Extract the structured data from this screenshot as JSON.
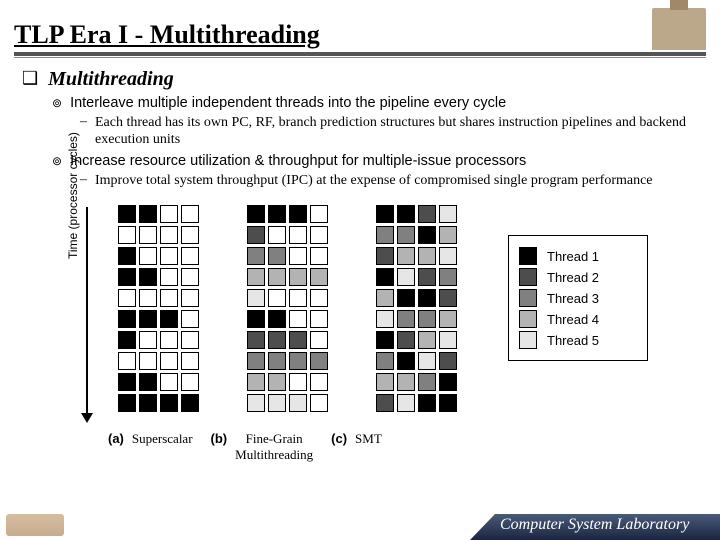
{
  "title": "TLP Era I - Multithreading",
  "section": "Multithreading",
  "bullets": {
    "b1": "Interleave multiple independent threads into the pipeline every cycle",
    "b1s": "Each thread has its own PC, RF, branch prediction structures but shares instruction pipelines and backend execution units",
    "b2": "Increase resource utilization & throughput for multiple-issue processors",
    "b2s": "Improve total system throughput (IPC) at the expense of compromised single program performance"
  },
  "figure": {
    "ylabel": "Time (processor cycles)",
    "captions": {
      "a_marker": "(a)",
      "a": "Superscalar",
      "b_marker": "(b)",
      "b_line1": "Fine-Grain",
      "b_line2": "Multithreading",
      "c_marker": "(c)",
      "c": "SMT"
    },
    "legend": {
      "t1": "Thread 1",
      "t2": "Thread 2",
      "t3": "Thread 3",
      "t4": "Thread 4",
      "t5": "Thread 5"
    }
  },
  "footer_lab": "Computer System Laboratory",
  "chart_data": {
    "type": "table",
    "description": "Three 10×4 issue-slot grids over processor cycles; 0 = empty slot, 1..5 = Thread N",
    "legend": [
      "Thread 1",
      "Thread 2",
      "Thread 3",
      "Thread 4",
      "Thread 5"
    ],
    "grids": {
      "superscalar": [
        [
          1,
          1,
          0,
          0
        ],
        [
          0,
          0,
          0,
          0
        ],
        [
          1,
          0,
          0,
          0
        ],
        [
          1,
          1,
          0,
          0
        ],
        [
          0,
          0,
          0,
          0
        ],
        [
          1,
          1,
          1,
          0
        ],
        [
          1,
          0,
          0,
          0
        ],
        [
          0,
          0,
          0,
          0
        ],
        [
          1,
          1,
          0,
          0
        ],
        [
          1,
          1,
          1,
          1
        ]
      ],
      "fine_grain": [
        [
          1,
          1,
          1,
          0
        ],
        [
          2,
          0,
          0,
          0
        ],
        [
          3,
          3,
          0,
          0
        ],
        [
          4,
          4,
          4,
          4
        ],
        [
          5,
          0,
          0,
          0
        ],
        [
          1,
          1,
          0,
          0
        ],
        [
          2,
          2,
          2,
          0
        ],
        [
          3,
          3,
          3,
          3
        ],
        [
          4,
          4,
          0,
          0
        ],
        [
          5,
          5,
          5,
          0
        ]
      ],
      "smt": [
        [
          1,
          1,
          2,
          5
        ],
        [
          3,
          3,
          1,
          4
        ],
        [
          2,
          4,
          4,
          5
        ],
        [
          1,
          5,
          2,
          3
        ],
        [
          4,
          1,
          1,
          2
        ],
        [
          5,
          3,
          3,
          4
        ],
        [
          1,
          2,
          4,
          5
        ],
        [
          3,
          1,
          5,
          2
        ],
        [
          4,
          4,
          3,
          1
        ],
        [
          2,
          5,
          1,
          1
        ]
      ]
    }
  }
}
